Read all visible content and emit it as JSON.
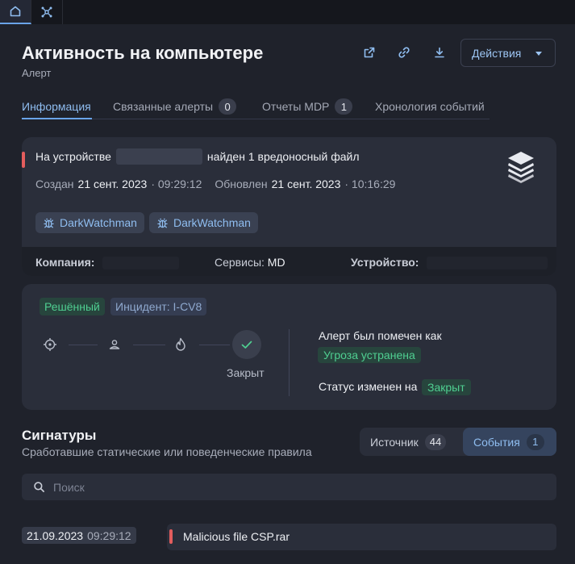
{
  "header": {
    "title": "Активность на компьютере",
    "subtitle": "Алерт",
    "actions_label": "Действия"
  },
  "tabs": [
    {
      "label": "Информация",
      "count": null
    },
    {
      "label": "Связанные алерты",
      "count": "0"
    },
    {
      "label": "Отчеты MDP",
      "count": "1"
    },
    {
      "label": "Хронология событий",
      "count": null
    }
  ],
  "alert": {
    "prefix": "На устройстве",
    "suffix": "найден 1 вредоносный файл",
    "created_label": "Создан",
    "created_date": "21 сент. 2023",
    "created_time": "· 09:29:12",
    "updated_label": "Обновлен",
    "updated_date": "21 сент. 2023",
    "updated_time": "· 10:16:29",
    "chips": [
      "DarkWatchman",
      "DarkWatchman"
    ],
    "footer": {
      "company_label": "Компания:",
      "services_label": "Сервисы:",
      "services_value": "MD",
      "device_label": "Устройство:"
    }
  },
  "status": {
    "resolved_tag": "Решённый",
    "incident_tag": "Инцидент: I-CV8",
    "closed_label": "Закрыт",
    "marked_text": "Алерт был помечен как",
    "marked_value": "Угроза устранена",
    "changed_text": "Статус изменен на",
    "changed_value": "Закрыт"
  },
  "signatures": {
    "title": "Сигнатуры",
    "subtitle": "Сработавшие статические или поведенческие правила",
    "source_label": "Источник",
    "source_count": "44",
    "events_label": "События",
    "events_count": "1",
    "search_placeholder": "Поиск",
    "events": [
      {
        "date": "21.09.2023",
        "time": "09:29:12",
        "name": "Malicious file CSP.rar"
      }
    ]
  },
  "colors": {
    "accent": "#8fbdf0",
    "danger": "#e35d5d",
    "success": "#4fcf91",
    "background": "#1f222b",
    "card": "#2a2e3a"
  }
}
